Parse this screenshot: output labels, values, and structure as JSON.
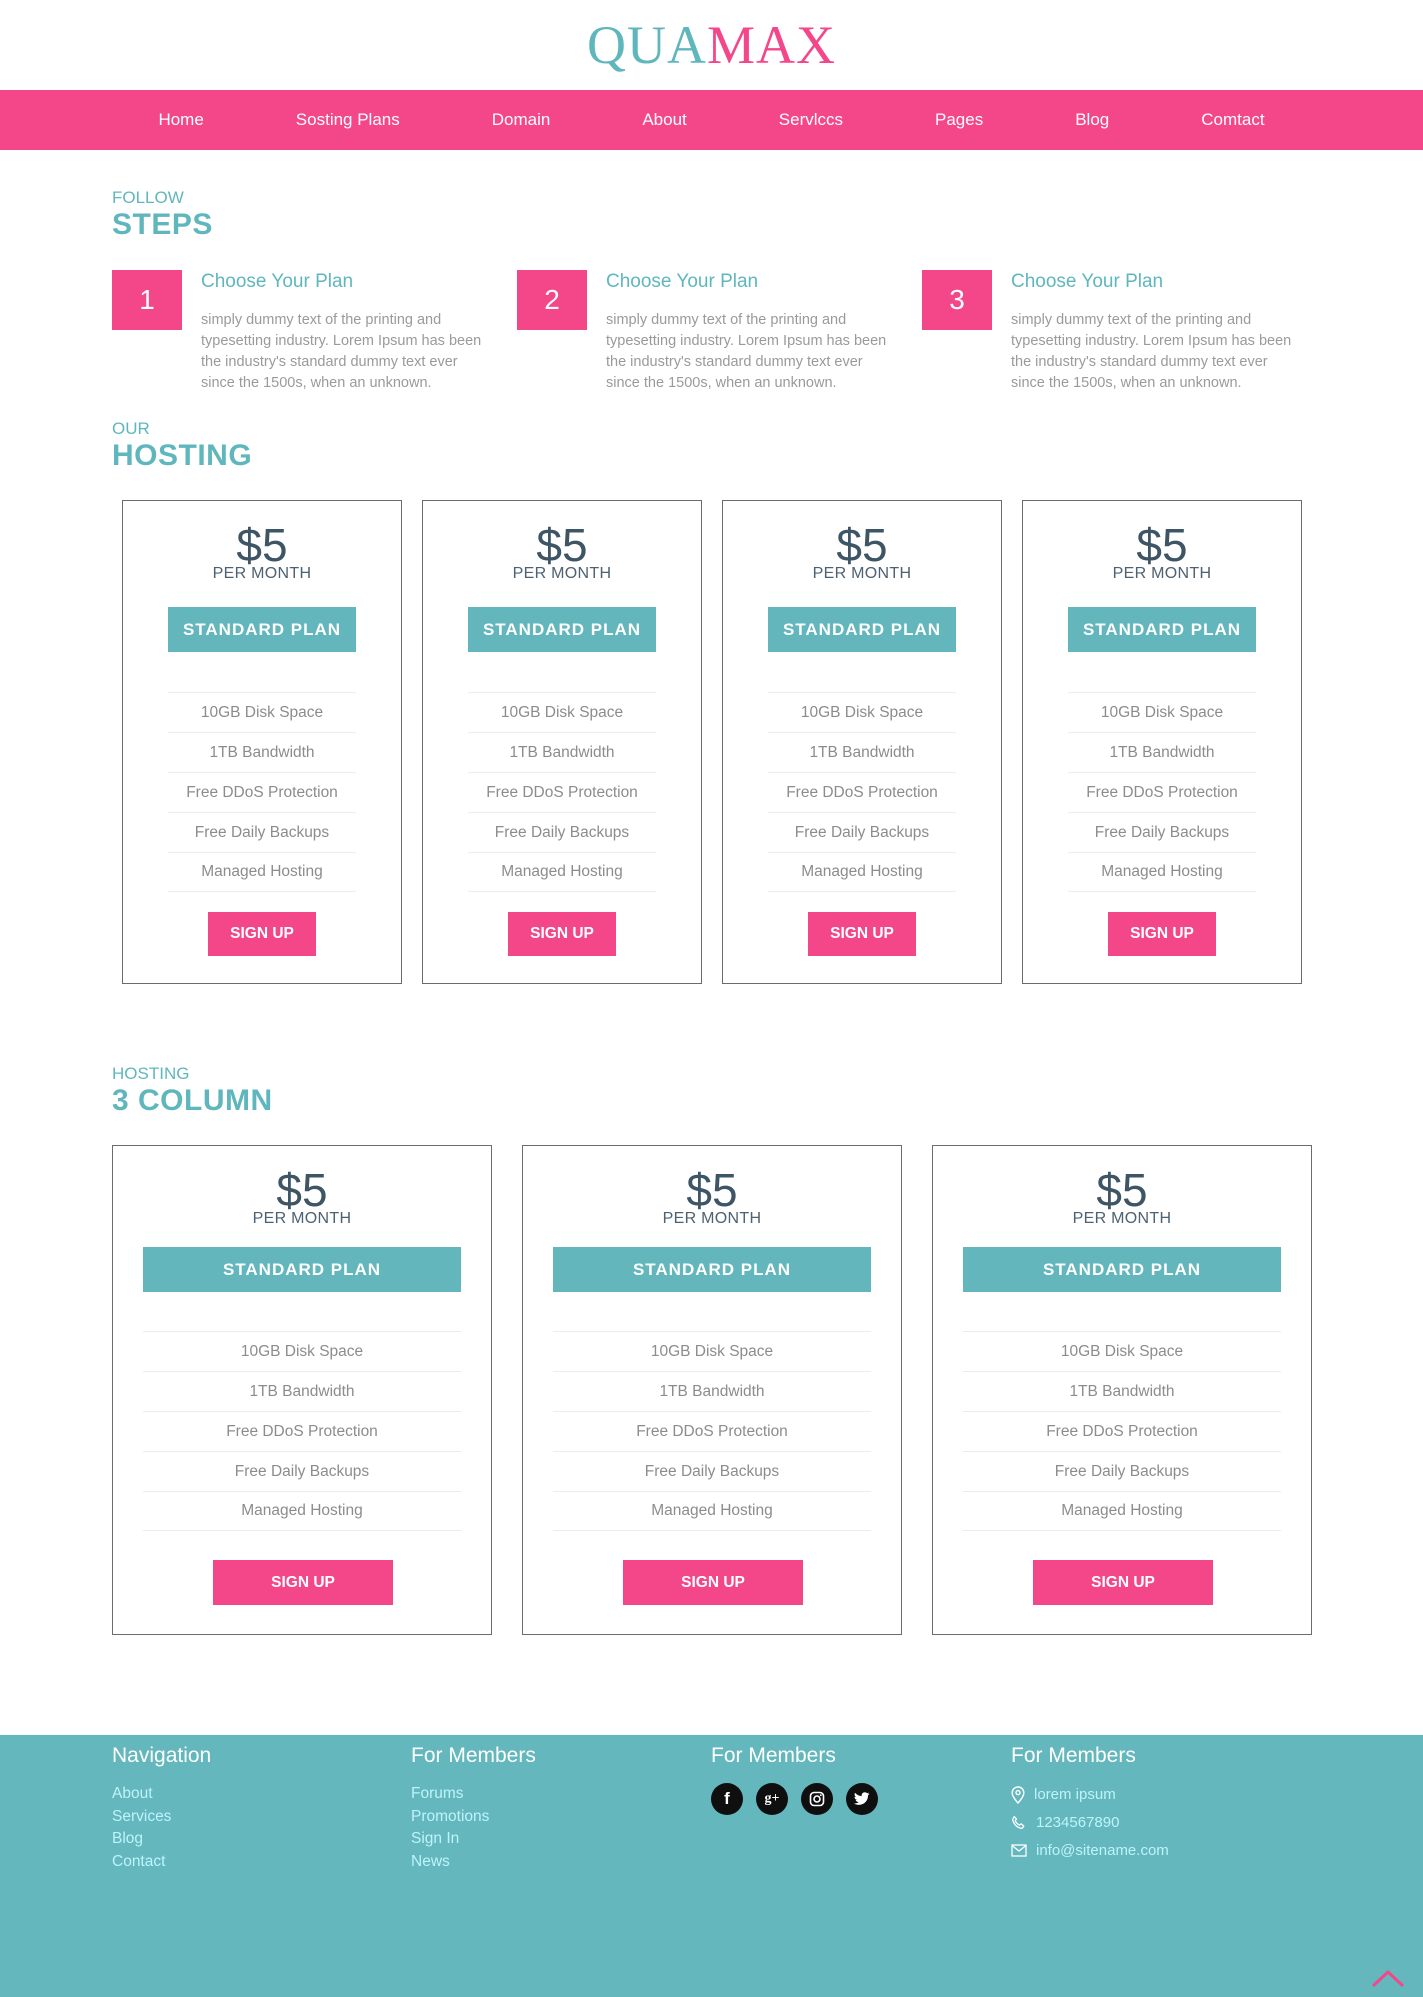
{
  "header": {
    "logo_part1": "QUA",
    "logo_part2": "MAX"
  },
  "nav": {
    "items": [
      "Home",
      "Sosting Plans",
      "Domain",
      "About",
      "Servlccs",
      "Pages",
      "Blog",
      "Comtact"
    ]
  },
  "steps_section": {
    "small_title": "FOLLOW",
    "big_title": "STEPS",
    "steps": [
      {
        "number": "1",
        "title": "Choose Your Plan",
        "text": "simply dummy text of the printing and typesetting industry. Lorem Ipsum has been the industry's standard dummy text ever since the 1500s, when an unknown."
      },
      {
        "number": "2",
        "title": "Choose Your Plan",
        "text": "simply dummy text of the printing and typesetting industry. Lorem Ipsum has been the industry's standard dummy text ever since the 1500s, when an unknown."
      },
      {
        "number": "3",
        "title": "Choose Your Plan",
        "text": "simply dummy text of the printing and typesetting industry. Lorem Ipsum has been the industry's standard dummy text ever since the 1500s, when an unknown."
      }
    ]
  },
  "hosting_section": {
    "small_title": "OUR",
    "big_title": "HOSTING",
    "plans": [
      {
        "price": "$5",
        "period": "PER MONTH",
        "plan_label": "STANDARD PLAN",
        "features": [
          "10GB Disk Space",
          "1TB Bandwidth",
          "Free DDoS Protection",
          "Free Daily Backups",
          "Managed Hosting"
        ],
        "signup_label": "SIGN UP"
      },
      {
        "price": "$5",
        "period": "PER MONTH",
        "plan_label": "STANDARD PLAN",
        "features": [
          "10GB Disk Space",
          "1TB Bandwidth",
          "Free DDoS Protection",
          "Free Daily Backups",
          "Managed Hosting"
        ],
        "signup_label": "SIGN UP"
      },
      {
        "price": "$5",
        "period": "PER MONTH",
        "plan_label": "STANDARD PLAN",
        "features": [
          "10GB Disk Space",
          "1TB Bandwidth",
          "Free DDoS Protection",
          "Free Daily Backups",
          "Managed Hosting"
        ],
        "signup_label": "SIGN UP"
      },
      {
        "price": "$5",
        "period": "PER MONTH",
        "plan_label": "STANDARD PLAN",
        "features": [
          "10GB Disk Space",
          "1TB Bandwidth",
          "Free DDoS Protection",
          "Free Daily Backups",
          "Managed Hosting"
        ],
        "signup_label": "SIGN UP"
      }
    ]
  },
  "three_col_section": {
    "small_title": "HOSTING",
    "big_title": "3 COLUMN",
    "plans": [
      {
        "price": "$5",
        "period": "PER MONTH",
        "plan_label": "STANDARD PLAN",
        "features": [
          "10GB Disk Space",
          "1TB Bandwidth",
          "Free DDoS Protection",
          "Free Daily Backups",
          "Managed Hosting"
        ],
        "signup_label": "SIGN UP"
      },
      {
        "price": "$5",
        "period": "PER MONTH",
        "plan_label": "STANDARD PLAN",
        "features": [
          "10GB Disk Space",
          "1TB Bandwidth",
          "Free DDoS Protection",
          "Free Daily Backups",
          "Managed Hosting"
        ],
        "signup_label": "SIGN UP"
      },
      {
        "price": "$5",
        "period": "PER MONTH",
        "plan_label": "STANDARD PLAN",
        "features": [
          "10GB Disk Space",
          "1TB Bandwidth",
          "Free DDoS Protection",
          "Free Daily Backups",
          "Managed Hosting"
        ],
        "signup_label": "SIGN UP"
      }
    ]
  },
  "footer": {
    "navigation": {
      "title": "Navigation",
      "links": [
        "About",
        "Services",
        "Blog",
        "Contact"
      ]
    },
    "members": {
      "title": "For Members",
      "links": [
        "Forums",
        "Promotions",
        "Sign In",
        "News"
      ]
    },
    "social": {
      "title": "For Members",
      "icons": [
        "facebook-icon",
        "google-plus-icon",
        "instagram-icon",
        "twitter-icon"
      ],
      "facebook_glyph": "f",
      "gplus_glyph": "g+"
    },
    "contact": {
      "title": "For Members",
      "address": "lorem ipsum",
      "phone": "1234567890",
      "email": "info@sitename.com"
    }
  },
  "colors": {
    "accent_pink": "#f4478a",
    "accent_teal": "#63b7bd",
    "dark_price": "#3e5566"
  }
}
